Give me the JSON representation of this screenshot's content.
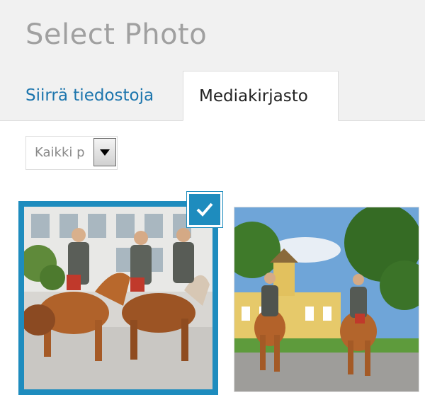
{
  "modal": {
    "title": "Select Photo"
  },
  "tabs": [
    {
      "label": "Siirrä tiedostoja",
      "active": false
    },
    {
      "label": "Mediakirjasto",
      "active": true
    }
  ],
  "filter": {
    "selected": "Kaikki p"
  },
  "attachments": [
    {
      "selected": true,
      "subject": "riders-on-street"
    },
    {
      "selected": false,
      "subject": "riders-by-yellow-building"
    }
  ],
  "colors": {
    "accent": "#1e8cbe",
    "link": "#1c75ad"
  }
}
